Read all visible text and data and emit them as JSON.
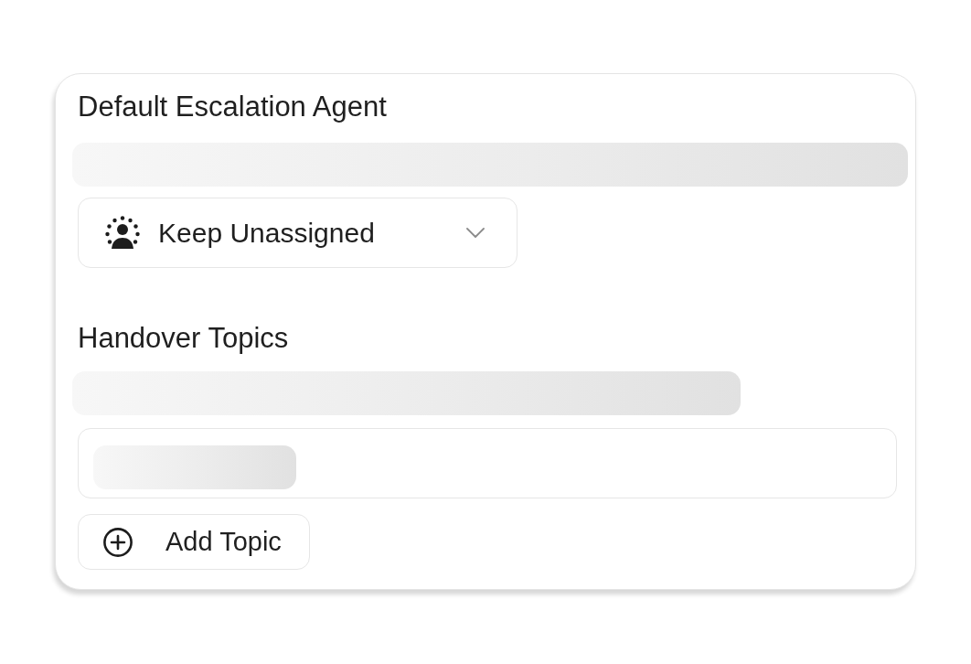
{
  "card": {
    "sections": [
      {
        "kind": "select",
        "title": "Default Escalation Agent",
        "loading": true,
        "select": {
          "value": "Keep Unassigned"
        }
      },
      {
        "kind": "topics",
        "title": "Handover Topics",
        "loading": true,
        "topics_loading": true,
        "add_button": "Add Topic"
      }
    ]
  }
}
